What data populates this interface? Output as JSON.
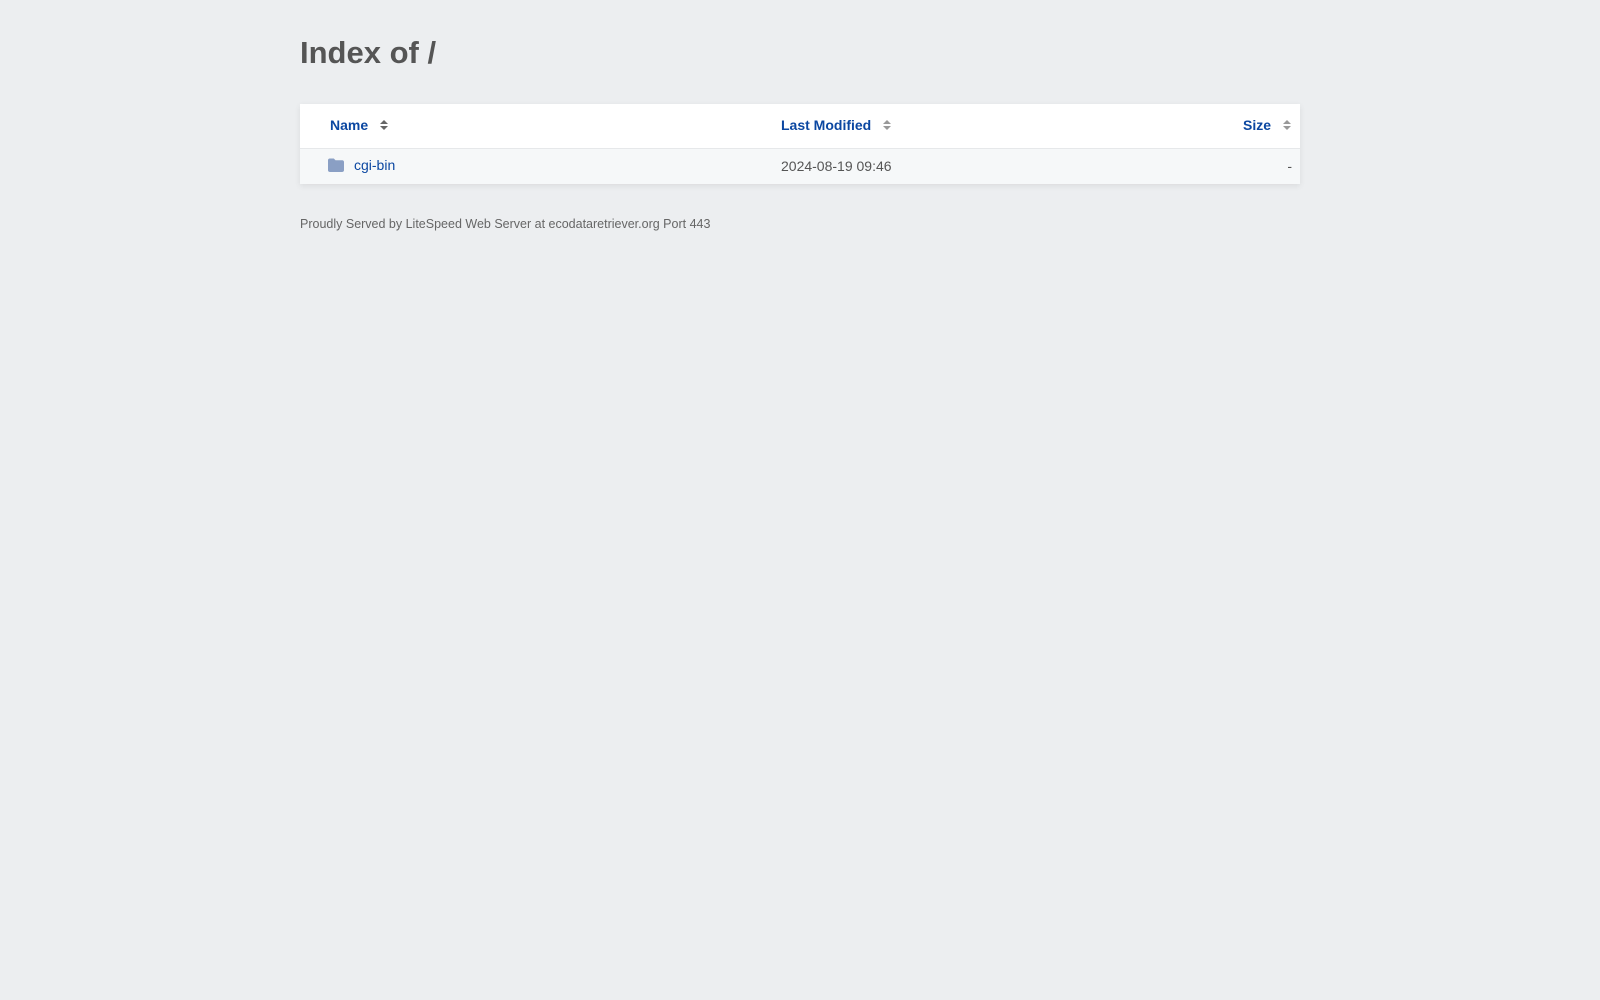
{
  "page": {
    "title": "Index of /"
  },
  "table": {
    "columns": {
      "name": "Name",
      "last_modified": "Last Modified",
      "size": "Size"
    },
    "rows": [
      {
        "name": "cgi-bin",
        "icon": "folder-icon",
        "last_modified": "2024-08-19 09:46",
        "size": "-"
      }
    ]
  },
  "footer": {
    "text": "Proudly Served by LiteSpeed Web Server at ecodataretriever.org Port 443"
  },
  "colors": {
    "background": "#eceef0",
    "link": "#0b47a1",
    "folder": "#8a9fc4"
  }
}
